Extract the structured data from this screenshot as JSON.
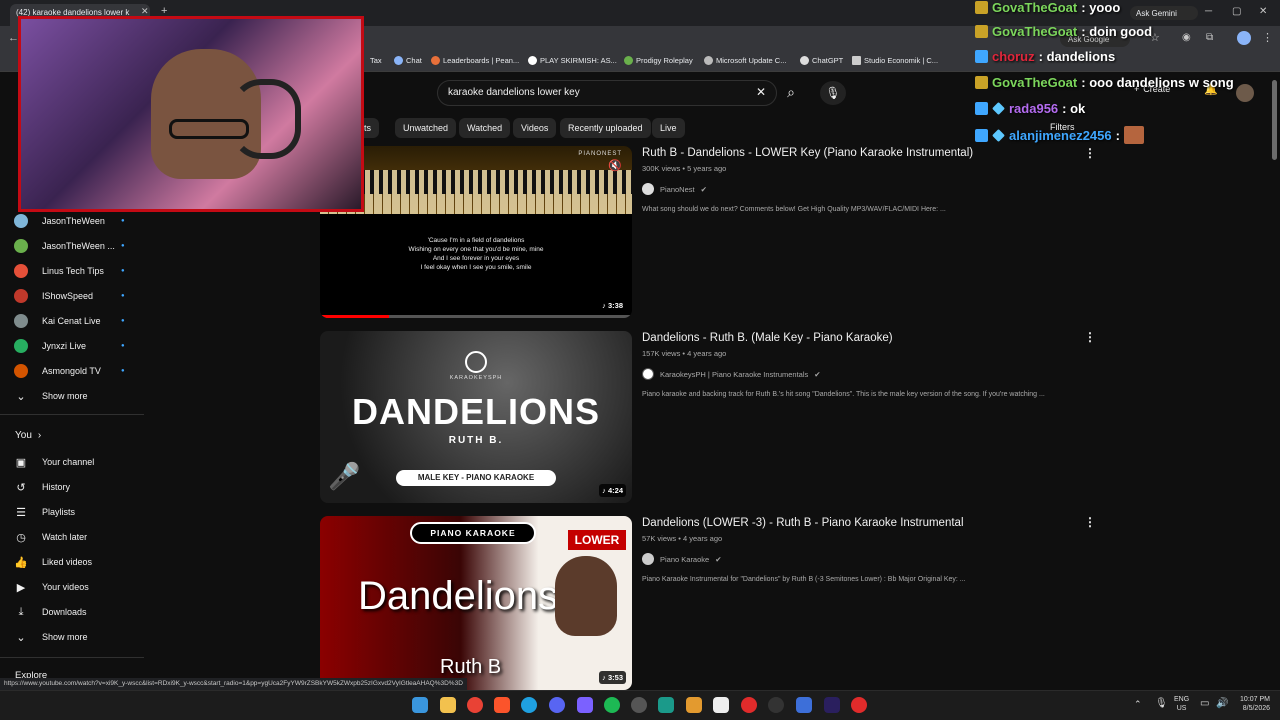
{
  "browser": {
    "tab_title": "(42) karaoke dandelions lower k",
    "bookmarks": [
      "Tax",
      "Chat",
      "Leaderboards | Pean...",
      "PLAY SKIRMISH: AS...",
      "Prodigy Roleplay",
      "Microsoft Update C...",
      "ChatGPT",
      "Studio Economik | C..."
    ],
    "ask_gemini": "Ask Gemini",
    "ask_google": "Ask Google",
    "status_url": "https://www.youtube.com/watch?v=xi9K_y-wscc&list=RDxi9K_y-wscc&start_radio=1&pp=ygUca2FyYW9rZSBkYW5kZWxpb25zIGxvd2VyIGtleaAHAQ%3D%3D"
  },
  "header": {
    "search_value": "karaoke dandelions lower key",
    "create_label": "Create",
    "filters_label": "Filters"
  },
  "chips": [
    "orts",
    "Unwatched",
    "Watched",
    "Videos",
    "Recently uploaded",
    "Live"
  ],
  "sidebar": {
    "subscriptions": [
      {
        "name": "JasonTheWeen",
        "color": "#7fb6d9"
      },
      {
        "name": "JasonTheWeen ...",
        "color": "#6ab04c"
      },
      {
        "name": "Linus Tech Tips",
        "color": "#e55039"
      },
      {
        "name": "IShowSpeed",
        "color": "#c0392b"
      },
      {
        "name": "Kai Cenat Live",
        "color": "#7f8c8d"
      },
      {
        "name": "Jynxzi Live",
        "color": "#27ae60"
      },
      {
        "name": "Asmongold TV",
        "color": "#d35400"
      }
    ],
    "show_more_1": "Show more",
    "you_label": "You",
    "you_items": [
      {
        "label": "Your channel",
        "icon": "person-icon",
        "glyph": "▣"
      },
      {
        "label": "History",
        "icon": "history-icon",
        "glyph": "↺"
      },
      {
        "label": "Playlists",
        "icon": "playlists-icon",
        "glyph": "☰"
      },
      {
        "label": "Watch later",
        "icon": "clock-icon",
        "glyph": "◷"
      },
      {
        "label": "Liked videos",
        "icon": "thumbs-up-icon",
        "glyph": "👍"
      },
      {
        "label": "Your videos",
        "icon": "video-icon",
        "glyph": "▶"
      },
      {
        "label": "Downloads",
        "icon": "download-icon",
        "glyph": "⤓"
      }
    ],
    "show_more_2": "Show more",
    "explore_label": "Explore"
  },
  "results": [
    {
      "title": "Ruth B - Dandelions - LOWER Key (Piano Karaoke Instrumental)",
      "meta": "300K views • 5 years ago",
      "channel": "PianoNest",
      "desc": "What song should we do next? Comments below! Get High Quality MP3/WAV/FLAC/MIDI Here: ...",
      "duration": "3:38",
      "thumb_brand": "PIANONEST",
      "lyrics": [
        "'Cause I'm in a field of dandelions",
        "Wishing on every one that you'd be mine, mine",
        "And I see forever in your eyes",
        "I feel okay when I see you smile, smile"
      ],
      "progress": 0.22
    },
    {
      "title": "Dandelions - Ruth B. (Male Key - Piano Karaoke)",
      "meta": "157K views • 4 years ago",
      "channel": "KaraokeysPH | Piano Karaoke Instrumentals",
      "desc": "Piano karaoke and backing track for Ruth B.'s hit song \"Dandelions\". This is the male key version of the song. If you're watching ...",
      "duration": "4:24",
      "thumb_brand": "KARAOKEYSPH",
      "thumb_title": "DANDELIONS",
      "thumb_artist": "RUTH B.",
      "thumb_pill": "MALE KEY - PIANO KARAOKE"
    },
    {
      "title": "Dandelions (LOWER -3) - Ruth B - Piano Karaoke Instrumental",
      "meta": "57K views • 4 years ago",
      "channel": "Piano Karaoke",
      "desc": "Piano Karaoke Instrumental for \"Dandelions\" by Ruth B (-3 Semitones Lower) : Bb Major Original Key: ...",
      "duration": "3:53",
      "thumb_brand": "PIANO KARAOKE",
      "thumb_tag": "LOWER",
      "thumb_title": "Dandelions",
      "thumb_artist": "Ruth B"
    }
  ],
  "chat": [
    {
      "user": "GovaTheGoat",
      "msg": "yooo",
      "color": "#7cd65c"
    },
    {
      "user": "GovaTheGoat",
      "msg": "doin good",
      "color": "#7cd65c"
    },
    {
      "user": "choruz",
      "msg": "dandelions",
      "color": "#e0263b"
    },
    {
      "user": "GovaTheGoat",
      "msg": "ooo dandelions w song",
      "color": "#7cd65c"
    },
    {
      "user": "rada956",
      "msg": "ok",
      "color": "#b46cf0"
    },
    {
      "user": "alanjimenez2456",
      "msg": "",
      "color": "#3fa7ff"
    }
  ],
  "taskbar": {
    "lang1": "ENG",
    "lang2": "US",
    "time": "10:07 PM",
    "date": "8/5/2026"
  }
}
